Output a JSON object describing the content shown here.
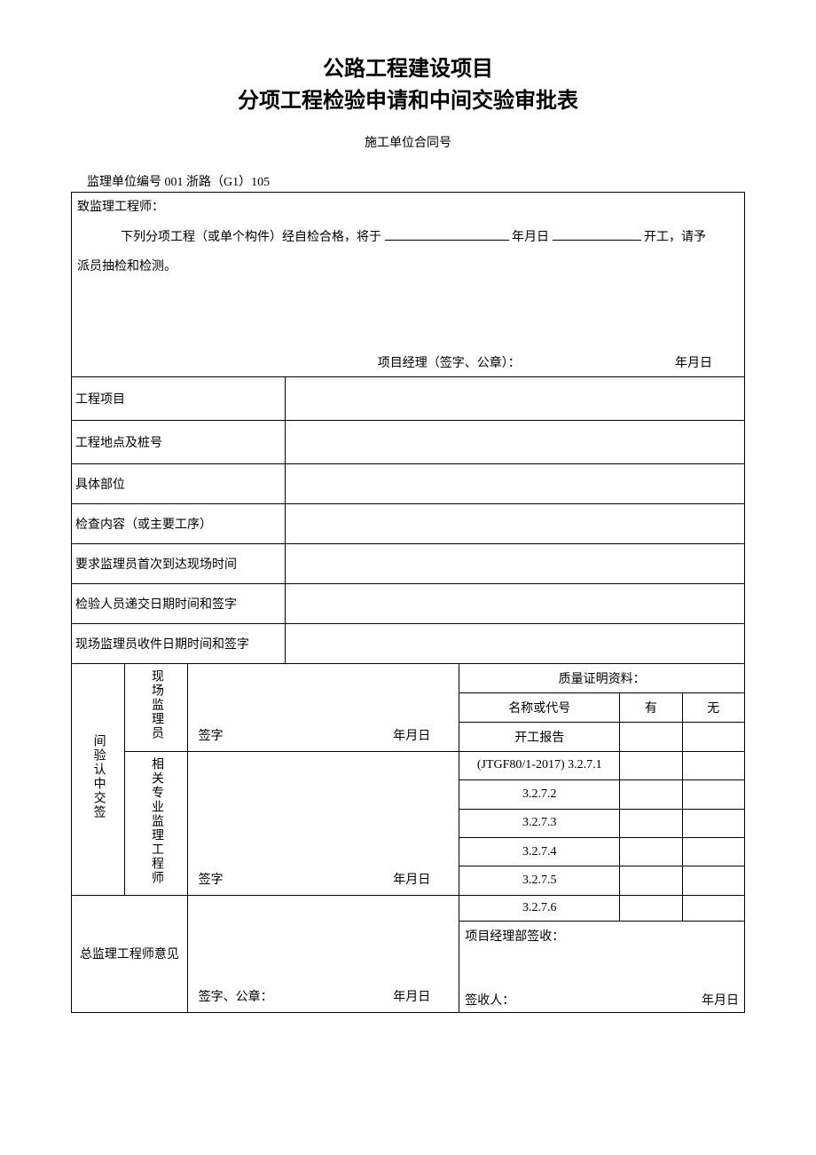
{
  "title_line1": "公路工程建设项目",
  "title_line2": "分项工程检验申请和中间交验审批表",
  "contract_label": "施工单位合同号",
  "ref_line": "监理单位编号 001 浙路（G1）105",
  "salutation": "致监理工程师：",
  "request_prefix": "下列分项工程（或单个构件）经自检合格，将于",
  "request_date_label": "年月日",
  "request_suffix": "开工，请予",
  "request_tail": "派员抽检和检测。",
  "pm_label": "项目经理（签字、公章）：",
  "ymd": "年月日",
  "rows": {
    "project": "工程项目",
    "location": "工程地点及桩号",
    "part": "具体部位",
    "content": "检查内容（或主要工序）",
    "first_arrival": "要求监理员首次到达现场时间",
    "submit": "检验人员递交日期时间和签字",
    "receive": "现场监理员收件日期时间和签字"
  },
  "confirm_col": "间验认中交签",
  "site_supervisor": "现场监理员",
  "specialty_engineer": "相关专业监理工程师",
  "sign_label": "签字",
  "quality_header": "质量证明资料：",
  "name_code": "名称或代号",
  "yes": "有",
  "no": "无",
  "doc_items": [
    "开工报告",
    "(JTGF80/1-2017) 3.2.7.1",
    "3.2.7.2",
    "3.2.7.3",
    "3.2.7.4",
    "3.2.7.5",
    "3.2.7.6"
  ],
  "chief_opinion": "总监理工程师意见",
  "sign_seal": "签字、公章：",
  "pm_receive": "项目经理部签收：",
  "receiver": "签收人："
}
